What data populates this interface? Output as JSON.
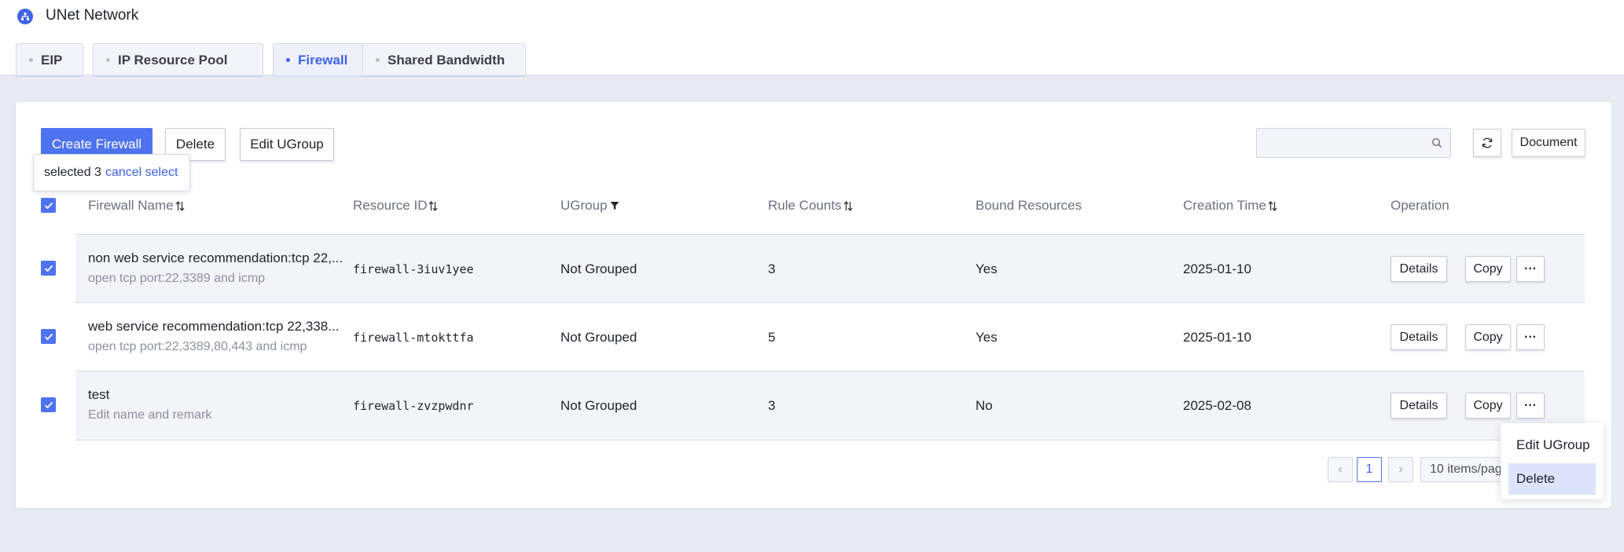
{
  "app": {
    "title": "UNet Network",
    "icon": "network-icon"
  },
  "tabs": [
    {
      "label": "EIP",
      "active": false
    },
    {
      "label": "IP Resource Pool",
      "active": false
    },
    {
      "label": "Firewall",
      "active": true
    },
    {
      "label": "Shared Bandwidth",
      "active": false
    }
  ],
  "toolbar": {
    "create_label": "Create Firewall",
    "delete_label": "Delete",
    "edit_ugroup_label": "Edit UGroup",
    "search_placeholder": "",
    "document_label": "Document"
  },
  "selection": {
    "text": "selected 3",
    "cancel_label": "cancel select"
  },
  "table": {
    "columns": [
      "Firewall Name",
      "Resource ID",
      "UGroup",
      "Rule Counts",
      "Bound Resources",
      "Creation Time",
      "Operation"
    ],
    "rows": [
      {
        "name": "non web service recommendation:tcp 22,...",
        "remark": "open tcp port:22,3389 and icmp",
        "resource_id": "firewall-3iuv1yee",
        "ugroup": "Not Grouped",
        "rule_counts": "3",
        "bound": "Yes",
        "created": "2025-01-10"
      },
      {
        "name": "web service recommendation:tcp 22,338...",
        "remark": "open tcp port:22,3389,80,443 and icmp",
        "resource_id": "firewall-mtokttfa",
        "ugroup": "Not Grouped",
        "rule_counts": "5",
        "bound": "Yes",
        "created": "2025-01-10"
      },
      {
        "name": "test",
        "remark": "Edit name and remark",
        "resource_id": "firewall-zvzpwdnr",
        "ugroup": "Not Grouped",
        "rule_counts": "3",
        "bound": "No",
        "created": "2025-02-08"
      }
    ],
    "op_details": "Details",
    "op_copy": "Copy",
    "op_more": "···"
  },
  "pagination": {
    "prev": "‹",
    "current": "1",
    "next": "›",
    "page_size": "10 items/page"
  },
  "more_menu": {
    "items": [
      "Edit UGroup",
      "Delete"
    ],
    "hovered": "Delete"
  },
  "colors": {
    "accent": "#4e73f0",
    "background": "#e8ebf2"
  }
}
